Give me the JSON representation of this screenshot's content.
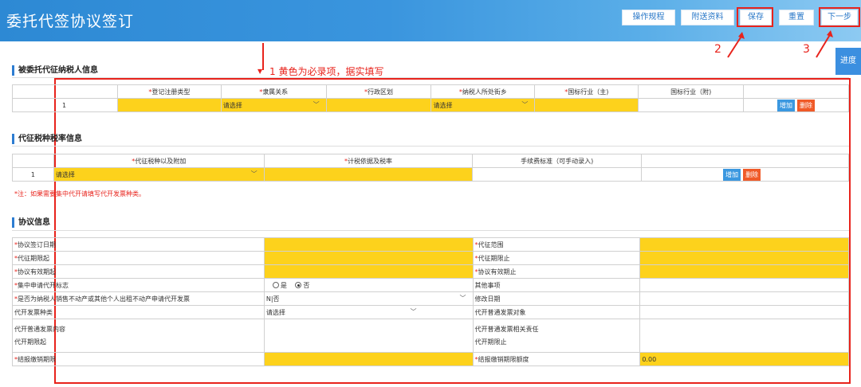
{
  "header": {
    "title": "委托代签协议签订",
    "buttons": {
      "rules": "操作规程",
      "attachments": "附送资料",
      "save": "保存",
      "reset": "重置",
      "next": "下一步"
    }
  },
  "annotations": {
    "note1": "1 黄色为必录项，据实填写",
    "num2": "2",
    "num3": "3"
  },
  "progress_label": "进度",
  "taxpayer": {
    "title": "被委托代征纳税人信息",
    "columns": [
      {
        "req": "*",
        "label": "登记注册类型"
      },
      {
        "req": "*",
        "label": "隶属关系"
      },
      {
        "req": "*",
        "label": "行政区划"
      },
      {
        "req": "*",
        "label": "纳税人所处街乡"
      },
      {
        "req": "*",
        "label": "国标行业（主)"
      },
      {
        "req": "",
        "label": "国标行业（附)"
      }
    ],
    "row_index": "1",
    "select_placeholder": "请选择",
    "add": "增加",
    "delete": "删除"
  },
  "tax": {
    "title": "代征税种税率信息",
    "columns": [
      {
        "req": "*",
        "label": "代征税种以及附加"
      },
      {
        "req": "*",
        "label": "计税依据及税率"
      },
      {
        "req": "",
        "label": "手续费标准（可手动录入)"
      }
    ],
    "row_index": "1",
    "select_placeholder": "请选择",
    "add": "增加",
    "delete": "删除",
    "note": "*注：如果需要集中代开请填写代开发票种类。"
  },
  "agreement": {
    "title": "协议信息",
    "sign_date": "协议签订日期",
    "scope": "代征范围",
    "period_start": "代征期限起",
    "period_end": "代征期限止",
    "valid_start": "协议有效期起",
    "valid_end": "协议有效期止",
    "central_flag": "集中申请代开标志",
    "yes": "是",
    "no": "否",
    "other": "其他事项",
    "resale_q": "是否为纳税人销售不动产或其他个人出租不动产申请代开发票",
    "resale_val": "N|否",
    "modify_date": "修改日期",
    "invoice_type": "代开发票种类",
    "invoice_placeholder": "请选择",
    "general_obj": "代开普通发票对象",
    "general_content": "代开普通发票内容",
    "general_resp": "代开普通发票相关责任",
    "open_start": "代开期限起",
    "open_end": "代开期限止",
    "settle_limit": "结报缴销期限",
    "settle_amount": "结报缴销期限额度",
    "settle_amount_val": "0.00"
  },
  "colors": {
    "yellow": "#fdd21c",
    "red": "#e8231c",
    "blue": "#3b98e0"
  }
}
